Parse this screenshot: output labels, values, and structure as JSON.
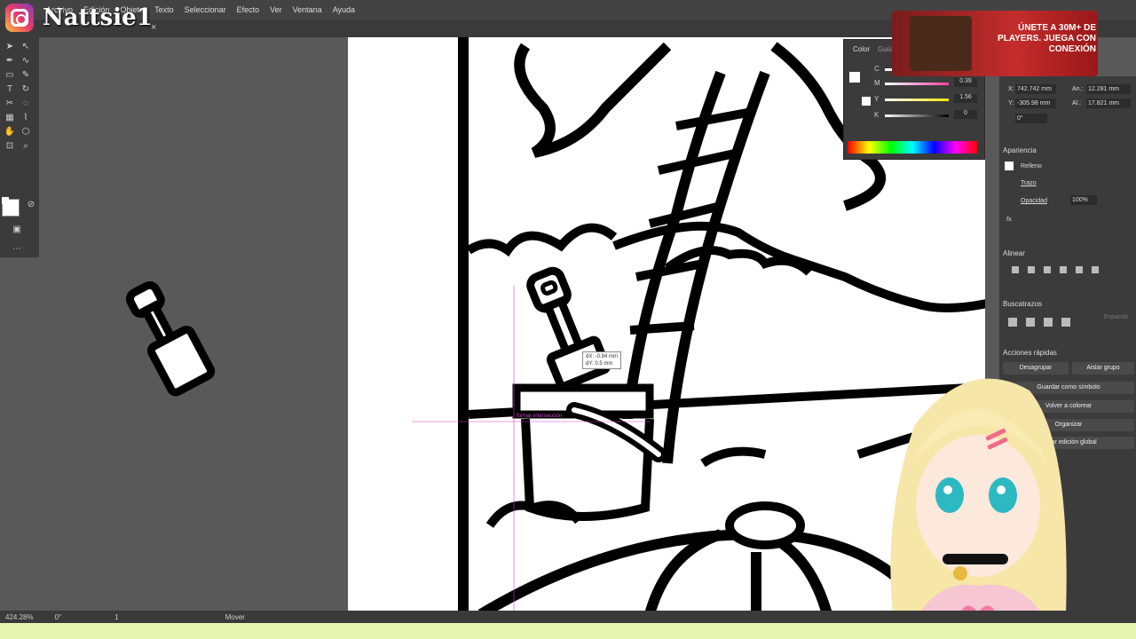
{
  "overlay": {
    "handle": "Nattsie1"
  },
  "menu": [
    "Archivo",
    "Edición",
    "Objeto",
    "Texto",
    "Seleccionar",
    "Efecto",
    "Ver",
    "Ventana",
    "Ayuda"
  ],
  "tab": {
    "close": "×"
  },
  "color_panel": {
    "tabs": [
      "Color",
      "Guía"
    ],
    "channels": [
      {
        "label": "C",
        "value": "",
        "color": "#00c0ff"
      },
      {
        "label": "M",
        "value": "0.39",
        "color": "#ff40a0"
      },
      {
        "label": "Y",
        "value": "1.56",
        "color": "#ffe400"
      },
      {
        "label": "K",
        "value": "0",
        "color": "#888888"
      }
    ],
    "unit": "%"
  },
  "ad": {
    "text": "ÚNETE A 30M+ DE PLAYERS. JUEGA CON CONEXIÓN"
  },
  "properties": {
    "x_label": "X:",
    "x_value": "742.742 mm",
    "y_label": "Y:",
    "y_value": "-305.98 mm",
    "w_label": "An.:",
    "w_value": "12.281 mm",
    "h_label": "Al.:",
    "h_value": "17.821 mm",
    "angle_value": "0°",
    "appearance_title": "Apariencia",
    "fill_label": "Relleno",
    "stroke_label": "Trazo",
    "opacity_label": "Opacidad",
    "opacity_value": "100%",
    "fx_label": "fx.",
    "align_title": "Alinear",
    "pathfinder_title": "Buscatrazos",
    "expand_label": "Expandir",
    "quick_actions_title": "Acciones rápidas",
    "buttons": [
      "Desagrupar",
      "Aislar grupo",
      "Guardar como símbolo",
      "Volver a colorear",
      "Organizar",
      "Iniciar edición global"
    ]
  },
  "canvas": {
    "tooltip_dx": "dX: -0.94 mm",
    "tooltip_dy": "dY: 0.5 mm",
    "smart_guide": "formar intersección"
  },
  "status": {
    "zoom": "424.28%",
    "rotation": "0°",
    "artboard": "1",
    "tool": "Mover"
  }
}
